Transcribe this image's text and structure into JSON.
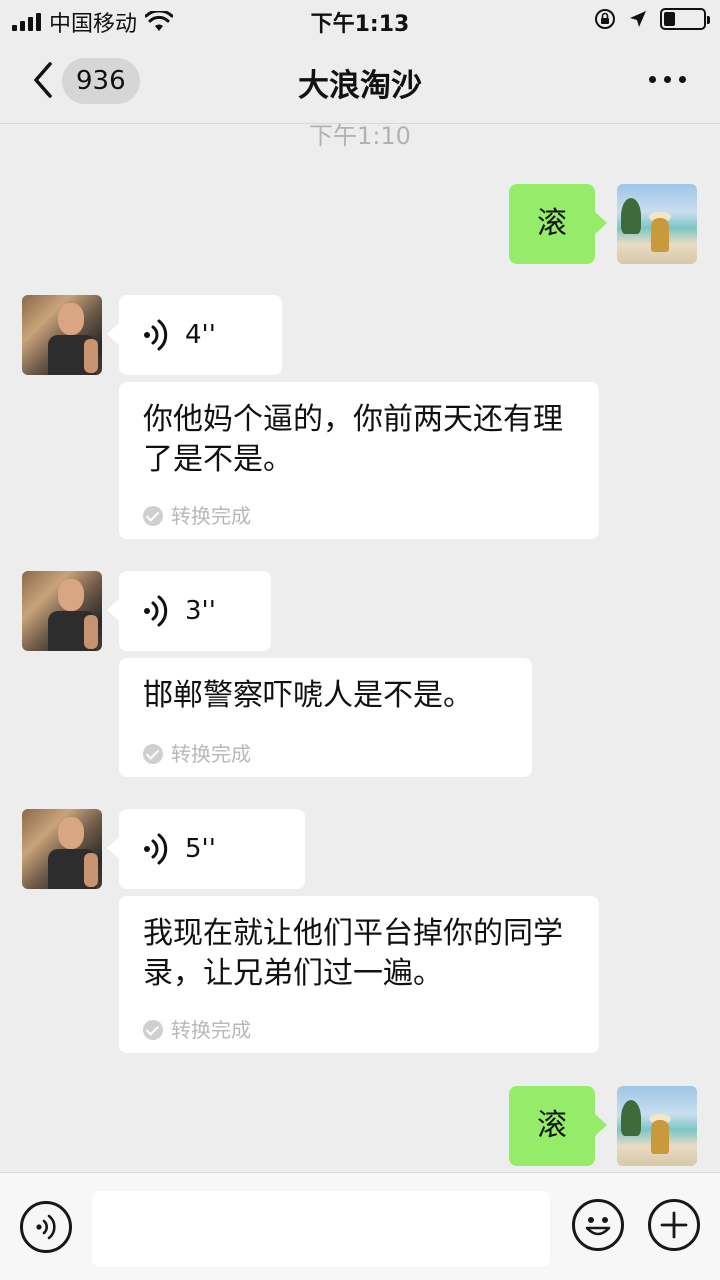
{
  "status_bar": {
    "carrier": "中国移动",
    "time": "下午1:13"
  },
  "nav": {
    "unread_count": "936",
    "title": "大浪淘沙"
  },
  "timestamp": "下午1:10",
  "messages": [
    {
      "sender": "self",
      "text": "滚"
    },
    {
      "sender": "other",
      "voice_duration": "4''",
      "transcription": "你他妈个逼的，你前两天还有理了是不是。",
      "status": "转换完成"
    },
    {
      "sender": "other",
      "voice_duration": "3''",
      "transcription": "邯郸警察吓唬人是不是。",
      "status": "转换完成"
    },
    {
      "sender": "other",
      "voice_duration": "5''",
      "transcription": "我现在就让他们平台掉你的同学录，让兄弟们过一遍。",
      "status": "转换完成"
    },
    {
      "sender": "self",
      "text": "滚"
    }
  ],
  "colors": {
    "background": "#ededed",
    "self_bubble": "#95ec69",
    "other_bubble": "#ffffff",
    "muted_text": "#b2b2b2"
  },
  "icons": {
    "back": "chevron-left-icon",
    "more": "more-dots-icon",
    "voice": "voice-wave-icon",
    "emoji": "emoji-icon",
    "plus": "plus-icon"
  }
}
